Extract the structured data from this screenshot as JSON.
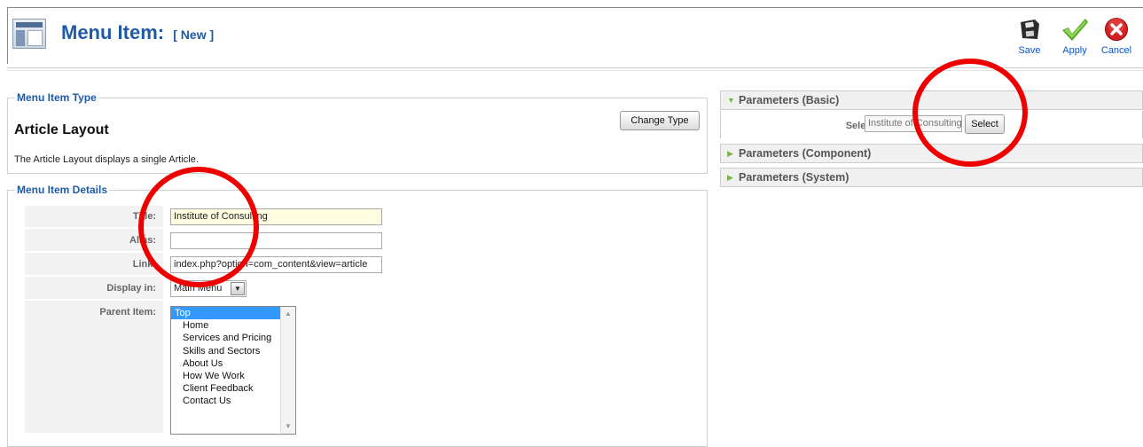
{
  "header": {
    "title": "Menu Item:",
    "subtitle": "[ New ]"
  },
  "toolbar": {
    "save_label": "Save",
    "apply_label": "Apply",
    "cancel_label": "Cancel"
  },
  "menu_item_type": {
    "legend": "Menu Item Type",
    "title": "Article Layout",
    "description": "The Article Layout displays a single Article.",
    "change_type_label": "Change Type"
  },
  "details": {
    "legend": "Menu Item Details",
    "title_label": "Title:",
    "title_value": "Institute of Consulting",
    "alias_label": "Alias:",
    "alias_value": "",
    "link_label": "Link:",
    "link_value": "index.php?option=com_content&view=article",
    "display_label": "Display in:",
    "display_value": "Main Menu",
    "parent_label": "Parent Item:",
    "parent_options": [
      "Top",
      "Home",
      "Services and Pricing",
      "Skills and Sectors",
      "About Us",
      "How We Work",
      "Client Feedback",
      "Contact Us"
    ]
  },
  "parameters": {
    "basic_title": "Parameters (Basic)",
    "select_article_label": "Select Article",
    "select_article_value": "Institute of Consulting",
    "select_button_label": "Select",
    "component_title": "Parameters (Component)",
    "system_title": "Parameters (System)"
  },
  "colors": {
    "title_blue": "#1f5aa6",
    "annotation_red": "#ee0000",
    "focus_yellow": "#fffde0",
    "selection_blue": "#3399ff"
  },
  "icons": {
    "header": "menu-manager-icon",
    "save": "floppy-disk-icon",
    "apply": "checkmark-icon",
    "cancel": "cancel-x-icon"
  }
}
